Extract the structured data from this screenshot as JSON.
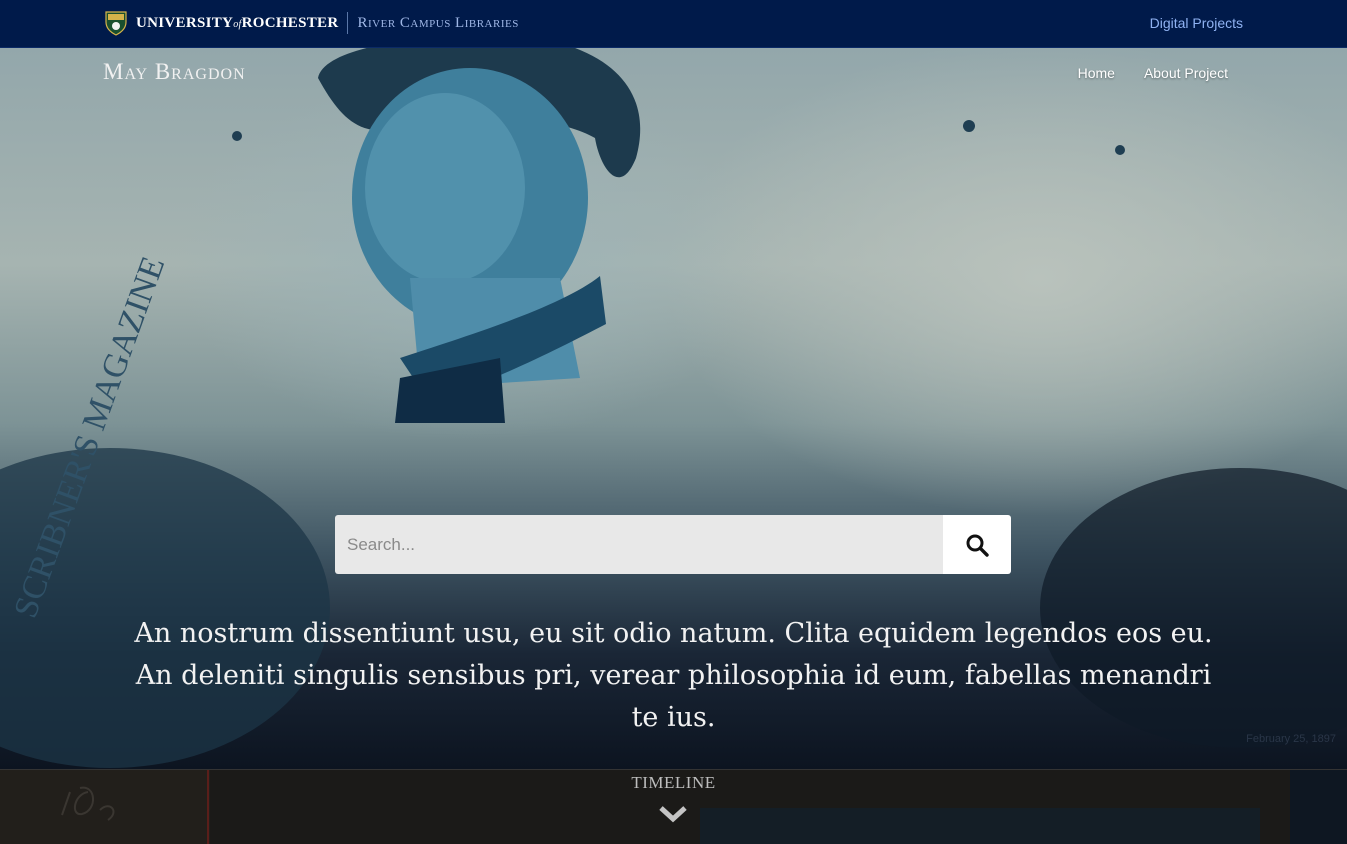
{
  "topbar": {
    "university_name_left": "UNIVERSITY",
    "university_name_of": "of",
    "university_name_right": "ROCHESTER",
    "libraries": "River Campus Libraries",
    "digital_projects": "Digital Projects"
  },
  "site": {
    "title": "May Bragdon",
    "nav": [
      "Home",
      "About Project"
    ]
  },
  "search": {
    "placeholder": "Search..."
  },
  "tagline": "An nostrum dissentiunt usu, eu sit odio natum. Clita equidem legendos eos eu. An deleniti singulis sensibus pri, verear philosophia id eum, fabellas menandri te ius.",
  "photo_caption": "February 25, 1897",
  "timeline": {
    "label": "TIMELINE"
  },
  "colors": {
    "topbar": "#001a4a",
    "link": "#8fb2f2",
    "hero_tone": "#7d9396"
  },
  "icons": [
    "university-shield-icon",
    "search-icon",
    "chevron-down-icon"
  ]
}
